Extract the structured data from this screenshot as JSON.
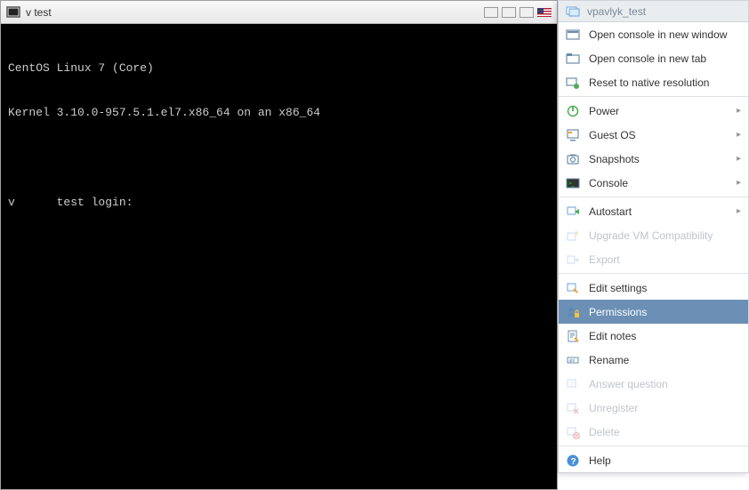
{
  "title_bar": {
    "title": "v           test"
  },
  "terminal": {
    "line1": "CentOS Linux 7 (Core)",
    "line2": "Kernel 3.10.0-957.5.1.el7.x86_64 on an x86_64",
    "line3": "v      test login:"
  },
  "context_menu": {
    "header": "vpavlyk_test",
    "items": {
      "open_new_window": "Open console in new window",
      "open_new_tab": "Open console in new tab",
      "reset_resolution": "Reset to native resolution",
      "power": "Power",
      "guest_os": "Guest OS",
      "snapshots": "Snapshots",
      "console": "Console",
      "autostart": "Autostart",
      "upgrade_vm": "Upgrade VM Compatibility",
      "export": "Export",
      "edit_settings": "Edit settings",
      "permissions": "Permissions",
      "edit_notes": "Edit notes",
      "rename": "Rename",
      "answer_question": "Answer question",
      "unregister": "Unregister",
      "delete": "Delete",
      "help": "Help"
    }
  }
}
